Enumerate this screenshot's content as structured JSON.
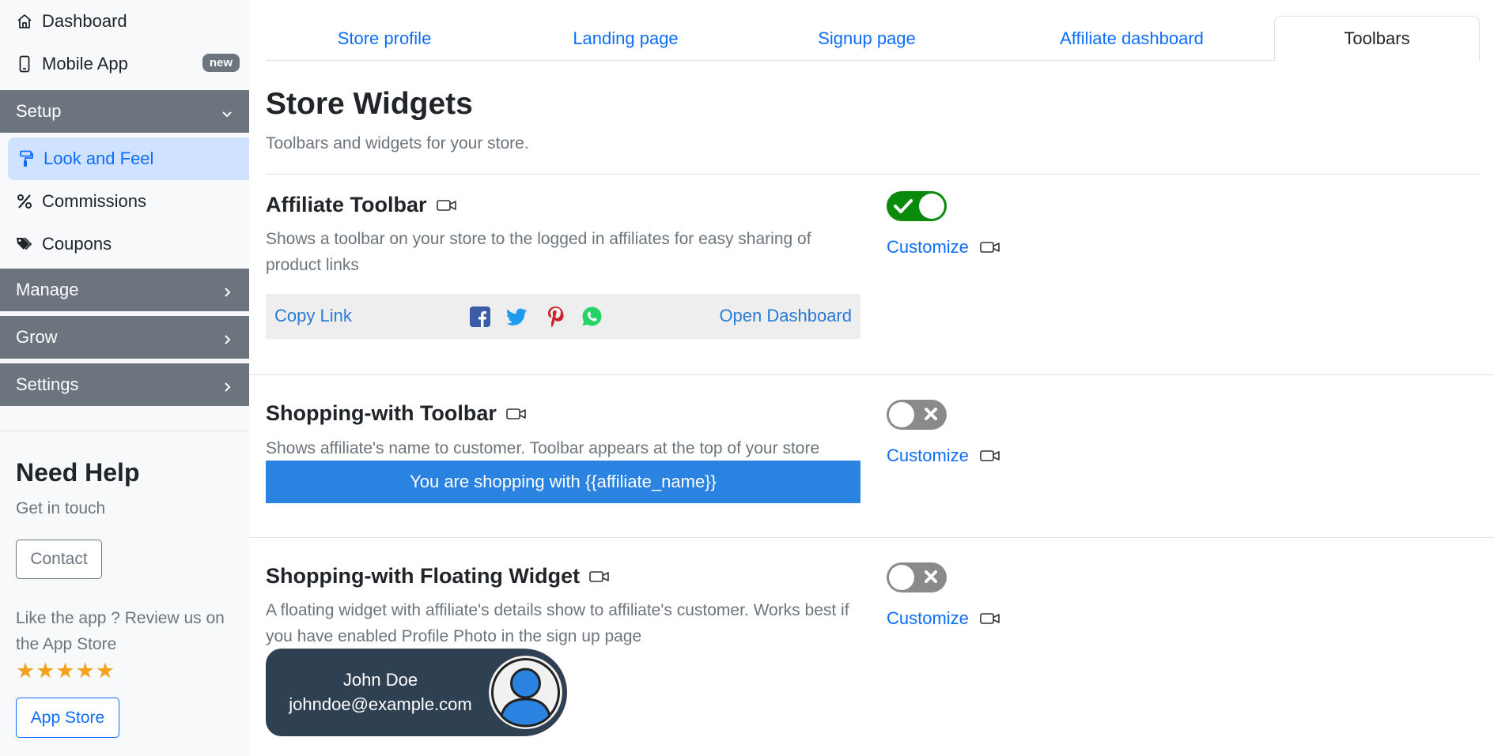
{
  "sidebar": {
    "dashboard": "Dashboard",
    "mobile_app": "Mobile App",
    "mobile_app_badge": "new",
    "setup": "Setup",
    "look_and_feel": "Look and Feel",
    "commissions": "Commissions",
    "coupons": "Coupons",
    "manage": "Manage",
    "grow": "Grow",
    "settings": "Settings",
    "help_title": "Need Help",
    "help_sub": "Get in touch",
    "contact": "Contact",
    "review": "Like the app ? Review us on the App Store",
    "stars": "★★★★★",
    "app_store": "App Store"
  },
  "tabs": [
    {
      "label": "Store profile"
    },
    {
      "label": "Landing page"
    },
    {
      "label": "Signup page"
    },
    {
      "label": "Affiliate dashboard"
    },
    {
      "label": "Toolbars"
    }
  ],
  "page": {
    "title": "Store Widgets",
    "subtitle": "Toolbars and widgets for your store."
  },
  "widgets": {
    "affiliate_toolbar": {
      "title": "Affiliate Toolbar",
      "desc": "Shows a toolbar on your store to the logged in affiliates for easy sharing of product links",
      "enabled": true,
      "customize": "Customize",
      "copy_link": "Copy Link",
      "open_dashboard": "Open Dashboard"
    },
    "shopping_toolbar": {
      "title": "Shopping-with Toolbar",
      "desc": "Shows affiliate's name to customer. Toolbar appears at the top of your store",
      "enabled": false,
      "customize": "Customize",
      "preview": "You are shopping with {{affiliate_name}}"
    },
    "floating_widget": {
      "title": "Shopping-with Floating Widget",
      "desc": "A floating widget with affiliate's details show to affiliate's customer. Works best if you have enabled Profile Photo in the sign up page",
      "enabled": false,
      "customize": "Customize",
      "name": "John Doe",
      "email": "johndoe@example.com"
    }
  },
  "colors": {
    "accent": "#0d6efd",
    "toggle_on": "#0a8a0a",
    "toggle_off": "#8a8a8a",
    "section_bg": "#6c757d",
    "active_bg": "#cfe2ff",
    "shop_bar": "#2a83e0",
    "widget_bg": "#2f4052",
    "stars": "#f7a01b"
  }
}
